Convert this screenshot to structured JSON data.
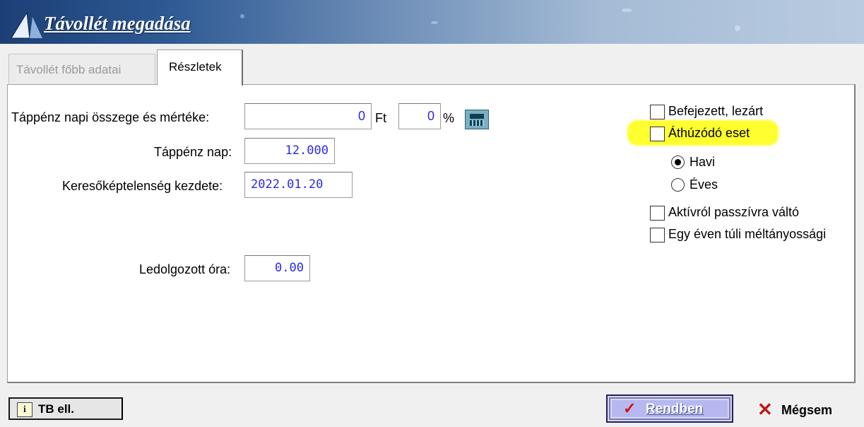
{
  "window": {
    "title": "Távollét megadása"
  },
  "tabs": [
    {
      "label": "Távollét főbb adatai",
      "active": false
    },
    {
      "label": "Részletek",
      "active": true
    }
  ],
  "form": {
    "tappenz_napi": {
      "label": "Táppénz napi összege és mértéke:",
      "amount": "0",
      "amount_unit": "Ft",
      "percent": "0",
      "percent_unit": "%"
    },
    "tappenz_nap": {
      "label": "Táppénz nap:",
      "value": "12.000"
    },
    "keresokeptelenseg": {
      "label": "Keresőképtelenség kezdete:",
      "value": "2022.01.20"
    },
    "ledolgozott": {
      "label": "Ledolgozott óra:",
      "value": "0.00"
    }
  },
  "options": {
    "befejezett": {
      "label": "Befejezett, lezárt",
      "checked": false
    },
    "athuzodo": {
      "label": "Áthúzódó eset",
      "checked": false
    },
    "havi": {
      "label": "Havi",
      "selected": true
    },
    "eves": {
      "label": "Éves",
      "selected": false
    },
    "aktivrol": {
      "label": "Aktívról passzívra váltó",
      "checked": false
    },
    "egy_even": {
      "label": "Egy éven túli méltányossági",
      "checked": false
    }
  },
  "buttons": {
    "tb_ell": {
      "label": "TB ell.",
      "icon": "info-icon"
    },
    "rendben": {
      "label": "Rendben",
      "icon": "checkmark-icon"
    },
    "megsem": {
      "label": "Mégsem",
      "icon": "close-icon"
    }
  },
  "colors": {
    "highlight": "#ffff30",
    "field_text": "#2a2ae0",
    "title_bar": "#2f5a94"
  }
}
